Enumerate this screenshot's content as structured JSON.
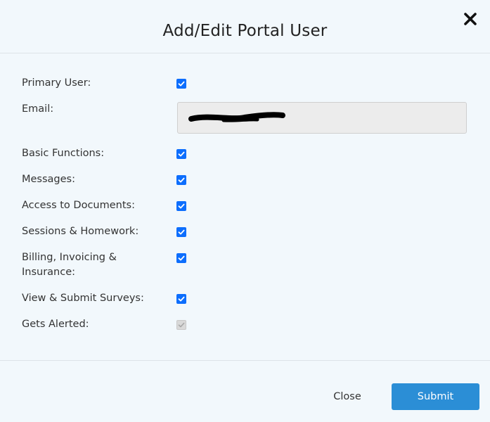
{
  "dialog": {
    "title": "Add/Edit Portal User",
    "close_icon": "close-x-icon"
  },
  "fields": {
    "primary_user": {
      "label": "Primary User:",
      "checked": true
    },
    "email": {
      "label": "Email:",
      "value": ""
    },
    "basic_functions": {
      "label": "Basic Functions:",
      "checked": true
    },
    "messages": {
      "label": "Messages:",
      "checked": true
    },
    "access_documents": {
      "label": "Access to Documents:",
      "checked": true
    },
    "sessions_homework": {
      "label": "Sessions & Homework:",
      "checked": true
    },
    "billing": {
      "label": "Billing, Invoicing & Insurance:",
      "checked": true
    },
    "surveys": {
      "label": "View & Submit Surveys:",
      "checked": true
    },
    "gets_alerted": {
      "label": "Gets Alerted:",
      "checked": true,
      "disabled": true
    }
  },
  "footer": {
    "close_label": "Close",
    "submit_label": "Submit"
  },
  "colors": {
    "checkbox_accent": "#0d6efd",
    "submit_bg": "#2b8ed6",
    "background": "#f2f8fc"
  }
}
